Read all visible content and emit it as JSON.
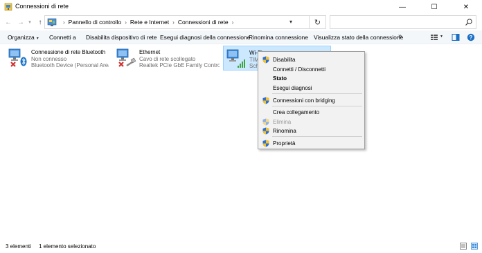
{
  "window": {
    "title": "Connessioni di rete",
    "minimize_glyph": "—",
    "maximize_glyph": "☐",
    "close_glyph": "✕"
  },
  "nav": {
    "back_glyph": "←",
    "forward_glyph": "→",
    "recent_glyph": "▾",
    "up_glyph": "↑",
    "refresh_glyph": "↻",
    "breadcrumb": [
      "Pannello di controllo",
      "Rete e Internet",
      "Connessioni di rete"
    ],
    "separator": "›",
    "dropdown_glyph": "▾"
  },
  "search": {
    "placeholder": ""
  },
  "commands": {
    "organize": "Organizza",
    "organize_caret": "▾",
    "connect": "Connetti a",
    "disable_device": "Disabilita dispositivo di rete",
    "diagnose": "Esegui diagnosi della connessione",
    "rename": "Rinomina connessione",
    "view_status": "Visualizza stato della connessione",
    "more": "»",
    "view_caret": "▾"
  },
  "connections": [
    {
      "name": "Connessione di rete Bluetooth",
      "status": "Non connesso",
      "device": "Bluetooth Device (Personal Area ...",
      "icon": "bluetooth-network-icon"
    },
    {
      "name": "Ethernet",
      "status": "Cavo di rete scollegato",
      "device": "Realtek PCIe GbE Family Controller",
      "icon": "ethernet-network-icon"
    },
    {
      "name": "Wi-Fi",
      "status": "TIM",
      "device": "Sche",
      "icon": "wifi-network-icon"
    }
  ],
  "context_menu": {
    "disable": "Disabilita",
    "connect_disconnect": "Connetti / Disconnetti",
    "status": "Stato",
    "diagnose": "Esegui diagnosi",
    "bridge": "Connessioni con bridging",
    "create_shortcut": "Crea collegamento",
    "delete": "Elimina",
    "rename": "Rinomina",
    "properties": "Proprietà"
  },
  "statusbar": {
    "count": "3 elementi",
    "selected": "1 elemento selezionato"
  },
  "colors": {
    "selection_bg": "#cce8ff",
    "selection_border": "#99d1ff",
    "error_red": "#d32f2f",
    "bluetooth_blue": "#1a73c9",
    "signal_green": "#3ba53b"
  }
}
